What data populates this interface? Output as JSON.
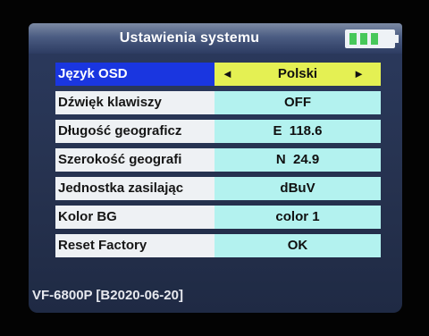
{
  "header": {
    "title": "Ustawienia systemu",
    "battery_level": "3/4"
  },
  "menu": [
    {
      "label": "Język OSD",
      "value": "Polski",
      "selected": true
    },
    {
      "label": "Dźwięk klawiszy",
      "value": "OFF"
    },
    {
      "label": "Długość geograficz",
      "value": "E  118.6"
    },
    {
      "label": "Szerokość geografi",
      "value": "N  24.9"
    },
    {
      "label": "Jednostka zasilając",
      "value": "dBuV"
    },
    {
      "label": "Kolor BG",
      "value": "color 1"
    },
    {
      "label": "Reset Factory",
      "value": "OK"
    }
  ],
  "arrows": {
    "left": "◄",
    "right": "►"
  },
  "footer": {
    "version": "VF-6800P [B2020-06-20]"
  },
  "colors": {
    "selected_label_bg": "#1a36e0",
    "selected_value_bg": "#e4f053",
    "value_bg": "#b3f2ef",
    "label_bg": "#eef1f4",
    "battery_fill": "#47c85a"
  }
}
